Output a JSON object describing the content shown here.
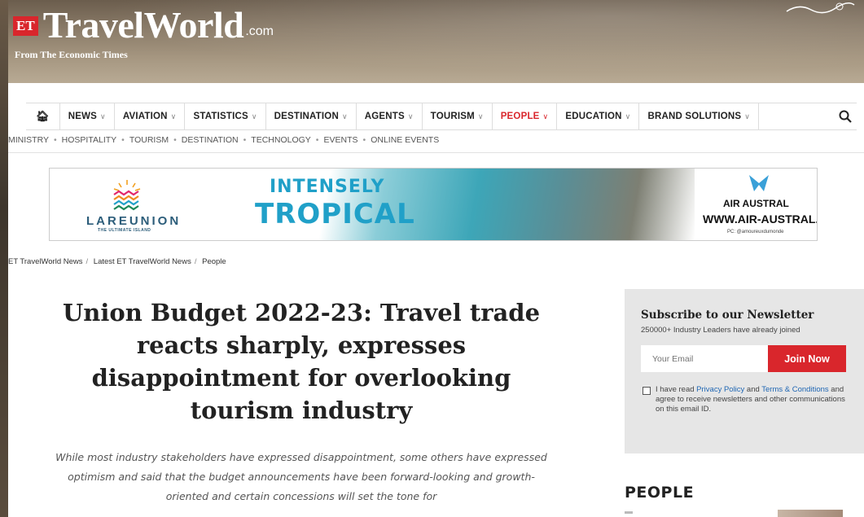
{
  "header": {
    "logo_badge": "ET",
    "logo_text": "TravelWorld",
    "logo_domain": ".com",
    "tagline": "From The Economic Times"
  },
  "nav": {
    "home_icon": "home-icon",
    "items": [
      {
        "label": "NEWS"
      },
      {
        "label": "AVIATION"
      },
      {
        "label": "STATISTICS"
      },
      {
        "label": "DESTINATION"
      },
      {
        "label": "AGENTS"
      },
      {
        "label": "TOURISM"
      },
      {
        "label": "PEOPLE"
      },
      {
        "label": "EDUCATION"
      },
      {
        "label": "BRAND SOLUTIONS"
      }
    ],
    "active_item": "PEOPLE",
    "search_icon": "search-icon"
  },
  "subnav": {
    "items": [
      "MINISTRY",
      "HOSPITALITY",
      "TOURISM",
      "DESTINATION",
      "TECHNOLOGY",
      "EVENTS",
      "ONLINE EVENTS"
    ]
  },
  "ad": {
    "brand_left": "LAREUNION",
    "brand_left_sub": "THE ULTIMATE ISLAND",
    "headline_1": "INTENSELY",
    "headline_2": "TROPICAL",
    "brand_right": "AIR AUSTRAL",
    "url": "WWW.AIR-AUSTRAL.COM",
    "credit": "PC: @amoureuxdumonde"
  },
  "breadcrumb": [
    "ET TravelWorld News",
    "Latest ET TravelWorld News",
    "People"
  ],
  "article": {
    "title": "Union Budget 2022-23: Travel trade reacts sharply, expresses disappointment for overlooking tourism industry",
    "summary": "While most industry stakeholders have expressed disappointment, some others have expressed optimism and said that the budget announcements have been forward-looking and growth-oriented and certain concessions will set the tone for"
  },
  "newsletter": {
    "title": "Subscribe to our Newsletter",
    "subtitle": "250000+ Industry Leaders have already joined",
    "email_placeholder": "Your Email",
    "button": "Join Now",
    "consent_pre": "I have read ",
    "privacy_link": "Privacy Policy",
    "consent_and": " and ",
    "terms_link": "Terms & Conditions",
    "consent_post": " and agree to receive newsletters and other communications on this email ID."
  },
  "sidebar": {
    "section_title": "PEOPLE"
  },
  "colors": {
    "accent": "#d9262c",
    "link": "#1f66b3",
    "aside_bg": "#e6e6e6"
  }
}
